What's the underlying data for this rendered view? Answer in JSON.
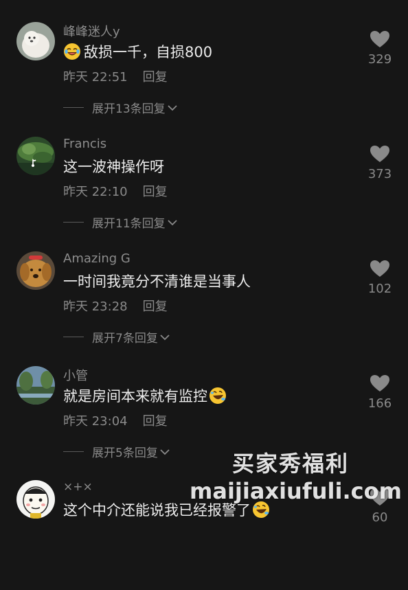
{
  "comments": [
    {
      "username": "峰峰迷人y",
      "text": "敌损一千，自损800",
      "emoji_lead": "laughing-crying-emoji",
      "time": "昨天 22:51",
      "reply_label": "回复",
      "expand_label": "展开13条回复",
      "likes": "329"
    },
    {
      "username": "Francis",
      "text": "这一波神操作呀",
      "time": "昨天 22:10",
      "reply_label": "回复",
      "expand_label": "展开11条回复",
      "likes": "373"
    },
    {
      "username": "Amazing G",
      "text": "一时间我竟分不清谁是当事人",
      "time": "昨天 23:28",
      "reply_label": "回复",
      "expand_label": "展开7条回复",
      "likes": "102"
    },
    {
      "username": "小管",
      "text": "就是房间本来就有监控",
      "emoji_trail": "laughing-rolling-emoji",
      "time": "昨天 23:04",
      "reply_label": "回复",
      "expand_label": "展开5条回复",
      "likes": "166"
    },
    {
      "username": "×+×",
      "text": "这个中介还能说我已经报警了",
      "emoji_trail": "laughing-rolling-emoji",
      "likes": "60"
    }
  ],
  "watermark": {
    "line1": "买家秀福利",
    "line2": "maijiaxiufuli.com"
  },
  "colors": {
    "background": "#161616",
    "text_primary": "#ededed",
    "text_secondary": "#8a8a8a",
    "heart": "#8a8a8a"
  }
}
